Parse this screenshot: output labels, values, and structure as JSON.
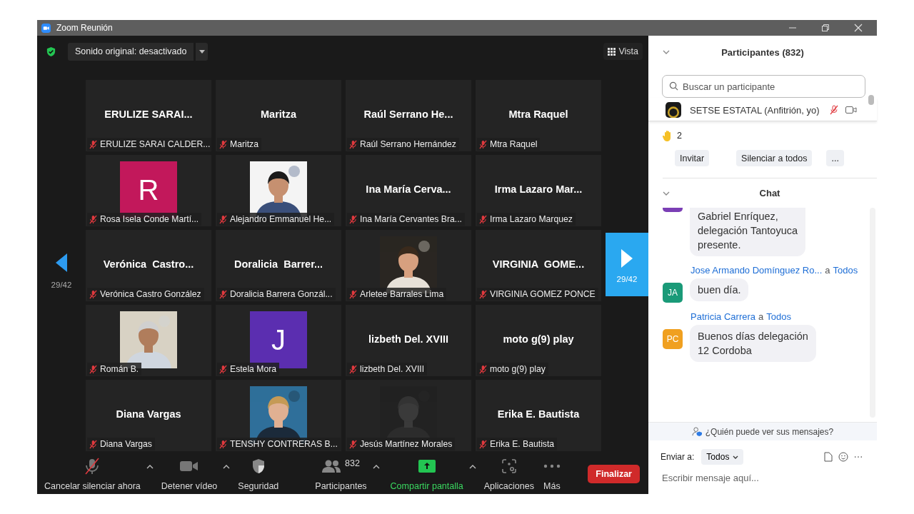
{
  "window": {
    "title": "Zoom Reunión"
  },
  "top_bar": {
    "sound_button": "Sonido original: desactivado",
    "view_button": "Vista"
  },
  "pager": {
    "left_label": "29/42",
    "right_label": "29/42"
  },
  "tiles": [
    {
      "kind": "name",
      "display": "ERULIZE SARAI...",
      "label": "ERULIZE SARAI CALDER...",
      "muted": true
    },
    {
      "kind": "name",
      "display": "Maritza",
      "label": "Maritza",
      "muted": true
    },
    {
      "kind": "name",
      "display": "Raúl Serrano He...",
      "label": "Raúl Serrano Hernández",
      "muted": true
    },
    {
      "kind": "name",
      "display": "Mtra Raquel",
      "label": "Mtra Raquel",
      "muted": true
    },
    {
      "kind": "letter",
      "display": "R",
      "color": "#c2185b",
      "label": "Rosa Isela Conde Martí...",
      "muted": true
    },
    {
      "kind": "picture",
      "label": "Alejandro Emmanuel He...",
      "muted": true
    },
    {
      "kind": "name",
      "display": "Ina María Cerva...",
      "label": "Ina María Cervantes Bra...",
      "muted": true
    },
    {
      "kind": "name",
      "display": "Irma Lazaro Mar...",
      "label": "Irma Lazaro Marquez",
      "muted": true
    },
    {
      "kind": "name",
      "display": "Verónica  Castro...",
      "label": "Verónica Castro González",
      "muted": true
    },
    {
      "kind": "name",
      "display": "Doralicia  Barrer...",
      "label": "Doralicia Barrera Gonzál...",
      "muted": true
    },
    {
      "kind": "picture",
      "label": "Arletee Barrales Lima",
      "muted": true
    },
    {
      "kind": "name",
      "display": "VIRGINIA  GOME...",
      "label": "VIRGINIA GOMEZ PONCE",
      "muted": true
    },
    {
      "kind": "picture",
      "label": "Román B.",
      "muted": true
    },
    {
      "kind": "letter",
      "display": "J",
      "color": "#5b2eb0",
      "label": "Estela Mora",
      "muted": true
    },
    {
      "kind": "name",
      "display": "lizbeth Del. XVIII",
      "label": "lizbeth Del. XVIII",
      "muted": true
    },
    {
      "kind": "name",
      "display": "moto g(9) play",
      "label": "moto g(9) play",
      "muted": true
    },
    {
      "kind": "name",
      "display": "Diana Vargas",
      "label": "Diana Vargas",
      "muted": true
    },
    {
      "kind": "picture",
      "label": "TENSHY CONTRERAS B...",
      "muted": true
    },
    {
      "kind": "picture",
      "label": "Jesús Martínez Morales",
      "muted": true
    },
    {
      "kind": "name",
      "display": "Erika E. Bautista",
      "label": "Erika E. Bautista",
      "muted": true
    }
  ],
  "toolbar": [
    {
      "kind": "audio",
      "label": "Cancelar silenciar ahora",
      "caret": true
    },
    {
      "kind": "video",
      "label": "Detener vídeo",
      "caret": true
    },
    {
      "kind": "security",
      "label": "Seguridad",
      "caret": false
    },
    {
      "kind": "participants",
      "label": "Participantes",
      "count": "832",
      "caret": true
    },
    {
      "kind": "share",
      "label": "Compartir pantalla",
      "caret": true
    },
    {
      "kind": "apps",
      "label": "Aplicaciones",
      "caret": false
    },
    {
      "kind": "more",
      "label": "Más",
      "caret": false
    }
  ],
  "end_button": "Finalizar",
  "participants_panel": {
    "title": "Participantes (832)",
    "search": {
      "placeholder": "Buscar un participante"
    },
    "host": {
      "name": "SETSE ESTATAL (Anfitrión, yo)",
      "muted": true
    },
    "raised_hands": "2",
    "buttons": [
      "Invitar",
      "Silenciar a todos",
      "..."
    ]
  },
  "chat": {
    "title": "Chat",
    "messages": [
      {
        "color": "#7b3fb5",
        "text": "Gabriel Enríquez,\ndelegación Tantoyuca\npresente."
      },
      {
        "sender": "Jose Armando Domínguez Ro...",
        "to_word": "a",
        "recipient": "Todos",
        "initials": "JA",
        "color": "#1a9a78",
        "text": "buen día."
      },
      {
        "sender": "Patricia Carrera",
        "to_word": "a",
        "recipient": "Todos",
        "initials": "PC",
        "color": "#f0a020",
        "text": "Buenos días delegación\n12 Cordoba"
      }
    ],
    "who_can_see": "¿Quién puede ver sus mensajes?",
    "send_to_label": "Enviar a:",
    "send_to_value": "Todos",
    "placeholder": "Escribir mensaje aquí..."
  }
}
